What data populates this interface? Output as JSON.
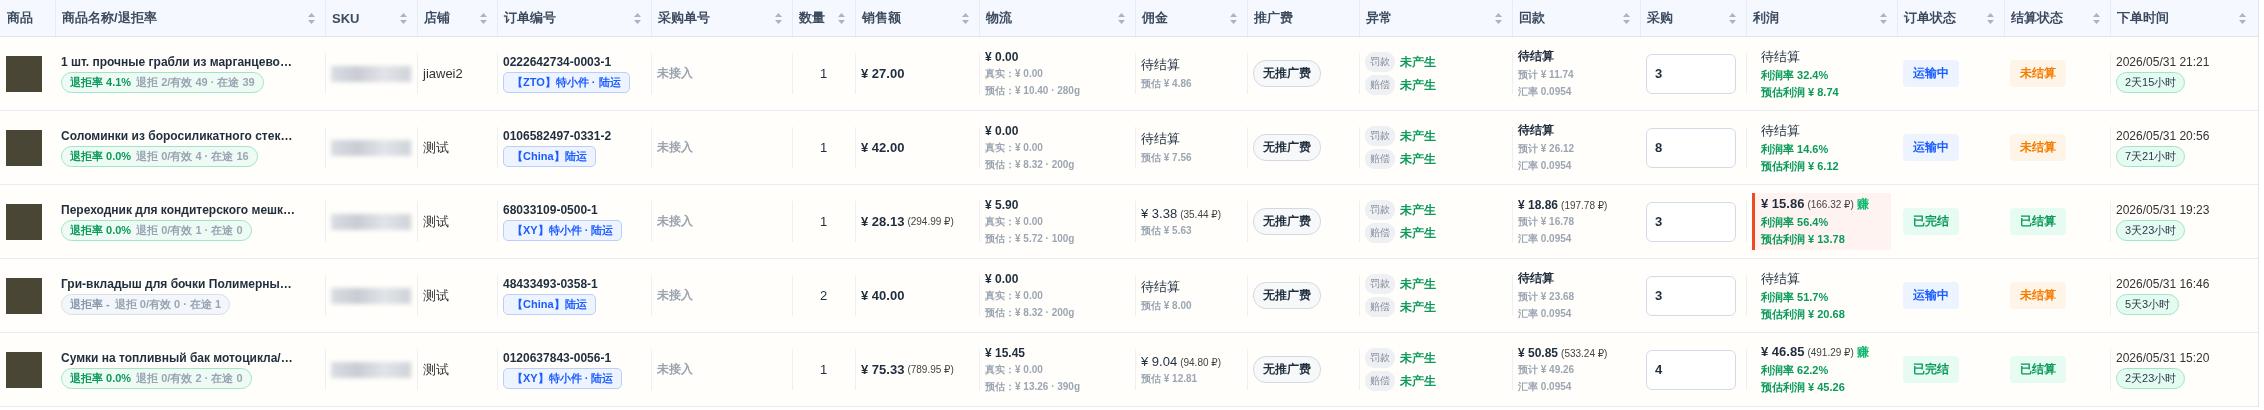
{
  "columns": [
    {
      "label": "商品",
      "sortable": false
    },
    {
      "label": "商品名称/退拒率",
      "sortable": true
    },
    {
      "label": "SKU",
      "sortable": true
    },
    {
      "label": "店铺",
      "sortable": true
    },
    {
      "label": "订单编号",
      "sortable": true
    },
    {
      "label": "采购单号",
      "sortable": true
    },
    {
      "label": "数量",
      "sortable": true
    },
    {
      "label": "销售额",
      "sortable": true
    },
    {
      "label": "物流",
      "sortable": true
    },
    {
      "label": "佣金",
      "sortable": true
    },
    {
      "label": "推广费",
      "sortable": false
    },
    {
      "label": "异常",
      "sortable": true
    },
    {
      "label": "回款",
      "sortable": true
    },
    {
      "label": "采购",
      "sortable": true
    },
    {
      "label": "利润",
      "sortable": true
    },
    {
      "label": "订单状态",
      "sortable": true
    },
    {
      "label": "结算状态",
      "sortable": true
    },
    {
      "label": "下单时间",
      "sortable": true
    }
  ],
  "rows": [
    {
      "name": "1 шт. прочные грабли из марганцево…",
      "reject": {
        "kind": "good",
        "rate": "退拒率 4.1%",
        "detail": "退拒 2/有效 49 · 在途 39"
      },
      "store": "jiawei2",
      "order_no": "0222642734-0003-1",
      "shipping": "【ZTO】特小件 · 陆运",
      "purchase_no": "未接入",
      "qty": "1",
      "sales": {
        "amount": "¥ 27.00"
      },
      "logistics": {
        "amount": "¥ 0.00",
        "real": "真实：¥ 0.00",
        "estimate": "预估：¥ 10.40 · 280g"
      },
      "commission": {
        "main": "待结算",
        "estimate": "预估 ¥ 4.86"
      },
      "promo": "无推广费",
      "anomalies": [
        {
          "label": "罚款",
          "value": "未产生"
        },
        {
          "label": "赔偿",
          "value": "未产生"
        }
      ],
      "payment": {
        "main": "待结算",
        "estimate": "预计 ¥ 11.74",
        "rate": "汇率 0.0954"
      },
      "purchase": "3",
      "profit": {
        "highlighted": false,
        "main": "待结算",
        "rate": "利润率 32.4%",
        "estimate": "预估利润 ¥ 8.74"
      },
      "order_status": {
        "label": "运输中",
        "kind": "shipping"
      },
      "settle_status": {
        "label": "未结算",
        "kind": "pending"
      },
      "time": "2026/05/31 21:21",
      "age": "2天15小时"
    },
    {
      "name": "Соломинки из боросиликатного стек…",
      "reject": {
        "kind": "good",
        "rate": "退拒率 0.0%",
        "detail": "退拒 0/有效 4 · 在途 16"
      },
      "store": "测试",
      "order_no": "0106582497-0331-2",
      "shipping": "【China】陆运",
      "purchase_no": "未接入",
      "qty": "1",
      "sales": {
        "amount": "¥ 42.00"
      },
      "logistics": {
        "amount": "¥ 0.00",
        "real": "真实：¥ 0.00",
        "estimate": "预估：¥ 8.32 · 200g"
      },
      "commission": {
        "main": "待结算",
        "estimate": "预估 ¥ 7.56"
      },
      "promo": "无推广费",
      "anomalies": [
        {
          "label": "罚款",
          "value": "未产生"
        },
        {
          "label": "赔偿",
          "value": "未产生"
        }
      ],
      "payment": {
        "main": "待结算",
        "estimate": "预计 ¥ 26.12",
        "rate": "汇率 0.0954"
      },
      "purchase": "8",
      "profit": {
        "highlighted": false,
        "main": "待结算",
        "rate": "利润率 14.6%",
        "estimate": "预估利润 ¥ 6.12"
      },
      "order_status": {
        "label": "运输中",
        "kind": "shipping"
      },
      "settle_status": {
        "label": "未结算",
        "kind": "pending"
      },
      "time": "2026/05/31 20:56",
      "age": "7天21小时"
    },
    {
      "name": "Переходник для кондитерского мешк…",
      "reject": {
        "kind": "good",
        "rate": "退拒率 0.0%",
        "detail": "退拒 0/有效 1 · 在途 0"
      },
      "store": "测试",
      "order_no": "68033109-0500-1",
      "shipping": "【XY】特小件 · 陆运",
      "purchase_no": "未接入",
      "qty": "1",
      "sales": {
        "amount": "¥ 28.13",
        "rub": "(294.99 ₽)"
      },
      "logistics": {
        "amount": "¥ 5.90",
        "real": "真实：¥ 0.00",
        "estimate": "预估：¥ 5.72 · 100g"
      },
      "commission": {
        "main": "¥ 3.38",
        "rub": "(35.44 ₽)",
        "estimate": "预估 ¥ 5.63"
      },
      "promo": "无推广费",
      "anomalies": [
        {
          "label": "罚款",
          "value": "未产生"
        },
        {
          "label": "赔偿",
          "value": "未产生"
        }
      ],
      "payment": {
        "main": "¥ 18.86",
        "rub": "(197.78 ₽)",
        "estimate": "预计 ¥ 16.78",
        "rate": "汇率 0.0954"
      },
      "purchase": "3",
      "profit": {
        "highlighted": true,
        "main": "¥ 15.86",
        "rub": "(166.32 ₽)",
        "tag": "赚",
        "rate": "利润率 56.4%",
        "estimate": "预估利润 ¥ 13.78"
      },
      "order_status": {
        "label": "已完结",
        "kind": "done"
      },
      "settle_status": {
        "label": "已结算",
        "kind": "settled"
      },
      "time": "2026/05/31 19:23",
      "age": "3天23小时"
    },
    {
      "name": "Гри-вкладыш для бочки Полимерны…",
      "reject": {
        "kind": "none",
        "rate": "退拒率 -",
        "detail": "退拒 0/有效 0 · 在途 1"
      },
      "store": "测试",
      "order_no": "48433493-0358-1",
      "shipping": "【China】陆运",
      "purchase_no": "未接入",
      "qty": "2",
      "sales": {
        "amount": "¥ 40.00"
      },
      "logistics": {
        "amount": "¥ 0.00",
        "real": "真实：¥ 0.00",
        "estimate": "预估：¥ 8.32 · 200g"
      },
      "commission": {
        "main": "待结算",
        "estimate": "预估 ¥ 8.00"
      },
      "promo": "无推广费",
      "anomalies": [
        {
          "label": "罚款",
          "value": "未产生"
        },
        {
          "label": "赔偿",
          "value": "未产生"
        }
      ],
      "payment": {
        "main": "待结算",
        "estimate": "预计 ¥ 23.68",
        "rate": "汇率 0.0954"
      },
      "purchase": "3",
      "profit": {
        "highlighted": false,
        "main": "待结算",
        "rate": "利润率 51.7%",
        "estimate": "预估利润 ¥ 20.68"
      },
      "order_status": {
        "label": "运输中",
        "kind": "shipping"
      },
      "settle_status": {
        "label": "未结算",
        "kind": "pending"
      },
      "time": "2026/05/31 16:46",
      "age": "5天3小时"
    },
    {
      "name": "Сумки на топливный бак мотоцикла/…",
      "reject": {
        "kind": "good",
        "rate": "退拒率 0.0%",
        "detail": "退拒 0/有效 2 · 在途 0"
      },
      "store": "测试",
      "order_no": "0120637843-0056-1",
      "shipping": "【XY】特小件 · 陆运",
      "purchase_no": "未接入",
      "qty": "1",
      "sales": {
        "amount": "¥ 75.33",
        "rub": "(789.95 ₽)"
      },
      "logistics": {
        "amount": "¥ 15.45",
        "real": "真实：¥ 0.00",
        "estimate": "预估：¥ 13.26 · 390g"
      },
      "commission": {
        "main": "¥ 9.04",
        "rub": "(94.80 ₽)",
        "estimate": "预估 ¥ 12.81"
      },
      "promo": "无推广费",
      "anomalies": [
        {
          "label": "罚款",
          "value": "未产生"
        },
        {
          "label": "赔偿",
          "value": "未产生"
        }
      ],
      "payment": {
        "main": "¥ 50.85",
        "rub": "(533.24 ₽)",
        "estimate": "预计 ¥ 49.26",
        "rate": "汇率 0.0954"
      },
      "purchase": "4",
      "profit": {
        "highlighted": false,
        "main": "¥ 46.85",
        "rub": "(491.29 ₽)",
        "tag": "赚",
        "rate": "利润率 62.2%",
        "estimate": "预估利润 ¥ 45.26"
      },
      "order_status": {
        "label": "已完结",
        "kind": "done"
      },
      "settle_status": {
        "label": "已结算",
        "kind": "settled"
      },
      "time": "2026/05/31 15:20",
      "age": "2天23小时"
    }
  ]
}
